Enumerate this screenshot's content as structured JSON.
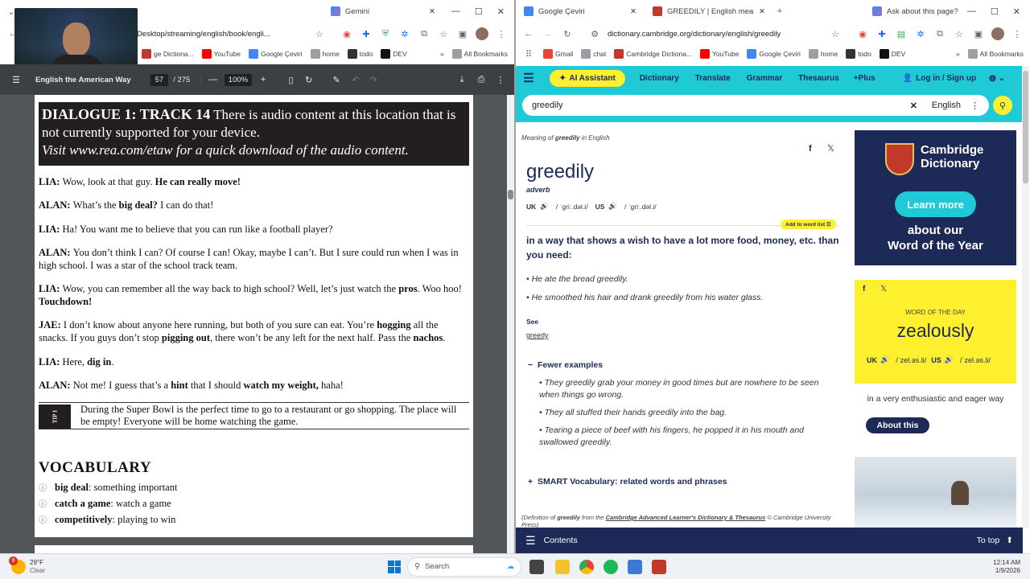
{
  "left_browser": {
    "tabs": [
      {
        "label": "Gemini"
      }
    ],
    "address": "C:/Users/admin/Desktop/streaming/english/book/engli...",
    "address_visible": "min/Desktop/streaming/english/book/engli...",
    "bookmarks": [
      "ge Dictiona...",
      "YouTube",
      "Google Çeviri",
      "home",
      "todo",
      "DEV"
    ],
    "all_bookmarks": "All Bookmarks"
  },
  "pdf": {
    "title": "English the American Way",
    "page_current": "57",
    "page_total": "/ 275",
    "zoom": "100%",
    "banner_heading": "DIALOGUE 1: TRACK 14",
    "banner_text1": " There is audio content at this location that is not currently supported for your device.",
    "banner_text2": "Visit www.rea.com/etaw for a quick download of the audio content.",
    "dialogue": [
      {
        "speaker": "LIA:",
        "html": "Wow, look at that guy. <b>He can really move!</b>"
      },
      {
        "speaker": "ALAN:",
        "html": "What’s the <b>big deal?</b> I can do that!"
      },
      {
        "speaker": "LIA:",
        "html": "Ha! You want me to believe that you can run like a football player?"
      },
      {
        "speaker": "ALAN:",
        "html": "You don’t think I can? Of course I can! Okay, maybe I can’t. But I sure could run when I was in high school. I was a star of the school track team."
      },
      {
        "speaker": "LIA:",
        "html": "Wow, you can remember all the way back to high school? Well, let’s just watch the <b>pros</b>. Woo hoo! <b>Touchdown!</b>"
      },
      {
        "speaker": "JAE:",
        "html": "I don’t know about anyone here running, but both of you sure can eat. You’re <b>hogging</b> all the snacks. If you guys don’t stop <b>pigging out</b>, there won’t be any left for the next half. Pass the <b>nachos</b>."
      },
      {
        "speaker": "LIA:",
        "html": "Here, <b>dig in</b>."
      },
      {
        "speaker": "ALAN:",
        "html": "Not me! I guess that’s a <b>hint</b> that I should <b>watch my weight,</b> haha!"
      }
    ],
    "tip_label": "TIP 1",
    "tip_text": "During the Super Bowl is the perfect time to go to a restaurant or go shopping. The place will be empty! Everyone will be home watching the game.",
    "vocab_heading": "VOCABULARY",
    "vocab": [
      {
        "term": "big deal",
        "def": ": something important"
      },
      {
        "term": "catch a game",
        "def": ": watch a game"
      },
      {
        "term": "competitively",
        "def": ": playing to win"
      }
    ]
  },
  "right_browser": {
    "tabs": [
      {
        "label": "Google Çeviri"
      },
      {
        "label": "GREEDILY | English meaning - C"
      },
      {
        "label": "Ask about this page?"
      }
    ],
    "address": "dictionary.cambridge.org/dictionary/english/greedily",
    "bookmarks": [
      "Gmail",
      "chat",
      "Cambridge Dictiona...",
      "YouTube",
      "Google Çeviri",
      "home",
      "todo",
      "DEV"
    ],
    "all_bookmarks": "All Bookmarks"
  },
  "cambridge": {
    "nav": {
      "ai": "AI Assistant",
      "dictionary": "Dictionary",
      "translate": "Translate",
      "grammar": "Grammar",
      "thesaurus": "Thesaurus",
      "plus": "+Plus",
      "login": "Log in / Sign up"
    },
    "search_value": "greedily",
    "search_lang": "English",
    "meaning_prefix": "Meaning of ",
    "meaning_word": "greedily",
    "meaning_suffix": " in English",
    "headword": "greedily",
    "pos": "adverb",
    "uk_label": "UK",
    "uk_ipa": "/ ˈɡriː.dəl.i/",
    "us_label": "US",
    "us_ipa": "/ ˈɡriː.dəl.i/",
    "add_word_list": "Add to word list",
    "definition": "in a way that shows a wish to have a lot more food, money, etc. than you need:",
    "examples": [
      "He ate the bread greedily.",
      "He smoothed his hair and drank greedily from his water glass."
    ],
    "see_label": "See",
    "see_link": "greedy",
    "fewer_examples": "Fewer examples",
    "more_examples": [
      "They greedily grab your money in good times but are nowhere to be seen when things go wrong.",
      "They all stuffed their hands greedily into the bag.",
      "Tearing a piece of beef with his fingers, he popped it in his mouth and swallowed greedily."
    ],
    "smart_vocab": "SMART Vocabulary: related words and phrases",
    "credit_prefix": "(Definition of ",
    "credit_word": "greedily",
    "credit_mid": " from the ",
    "credit_source": "Cambridge Advanced Learner's Dictionary & Thesaurus",
    "credit_suffix": " © Cambridge University Press)",
    "ad_title1": "Cambridge",
    "ad_title2": "Dictionary",
    "ad_button": "Learn more",
    "ad_sub1": "about our",
    "ad_sub2": "Word of the Year",
    "wotd_label": "WORD OF THE DAY",
    "wotd_word": "zealously",
    "wotd_uk": "UK",
    "wotd_uk_ipa": "/ˈzel.əs.li/",
    "wotd_us": "US",
    "wotd_us_ipa": "/ˈzel.əs.li/",
    "wotd_def": "in a very enthusiastic and eager way",
    "wotd_button": "About this",
    "footer_contents": "Contents",
    "footer_top": "To top"
  },
  "taskbar": {
    "weather_temp": "29°F",
    "weather_desc": "Clear",
    "weather_badge": "9",
    "search": "Search",
    "time": "12:14 AM",
    "date": "1/9/2026"
  },
  "colors": {
    "cambridge_teal": "#1fc9d6",
    "cambridge_navy": "#1d2a57",
    "wotd_yellow": "#fef02f",
    "pdf_toolbar": "#3c4043"
  }
}
